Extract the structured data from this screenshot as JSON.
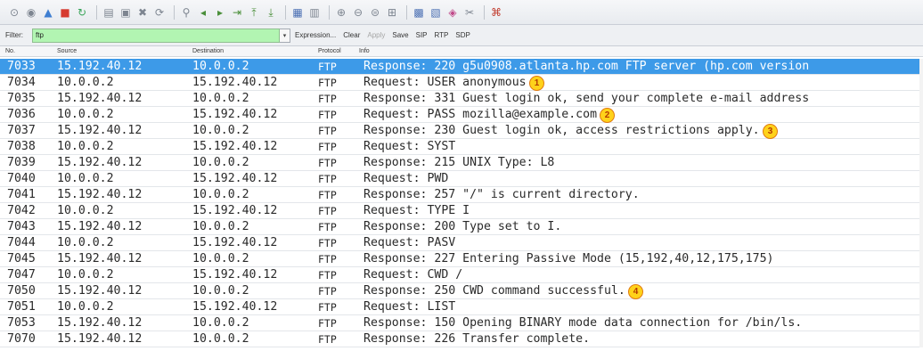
{
  "toolbar": {
    "icons": [
      {
        "name": "interface-list-icon",
        "glyph": "⊙",
        "color": "#7d8590"
      },
      {
        "name": "capture-options-icon",
        "glyph": "◉",
        "color": "#7d8590"
      },
      {
        "name": "start-capture-icon",
        "glyph": "▲",
        "color": "#3f7fd1"
      },
      {
        "name": "stop-capture-icon",
        "glyph": "■",
        "color": "#d63a2f"
      },
      {
        "name": "restart-capture-icon",
        "glyph": "↻",
        "color": "#3aa55a"
      },
      {
        "name": "sep",
        "glyph": ""
      },
      {
        "name": "open-file-icon",
        "glyph": "▤",
        "color": "#7d8590"
      },
      {
        "name": "save-file-icon",
        "glyph": "▣",
        "color": "#7d8590"
      },
      {
        "name": "close-file-icon",
        "glyph": "✖",
        "color": "#7d8590"
      },
      {
        "name": "reload-file-icon",
        "glyph": "⟳",
        "color": "#7d8590"
      },
      {
        "name": "sep",
        "glyph": ""
      },
      {
        "name": "find-packet-icon",
        "glyph": "⚲",
        "color": "#7d8590"
      },
      {
        "name": "go-back-icon",
        "glyph": "◂",
        "color": "#4a8f3a"
      },
      {
        "name": "go-forward-icon",
        "glyph": "▸",
        "color": "#4a8f3a"
      },
      {
        "name": "go-to-packet-icon",
        "glyph": "⇥",
        "color": "#4a8f3a"
      },
      {
        "name": "first-packet-icon",
        "glyph": "⤒",
        "color": "#4a8f3a"
      },
      {
        "name": "last-packet-icon",
        "glyph": "⤓",
        "color": "#4a8f3a"
      },
      {
        "name": "sep",
        "glyph": ""
      },
      {
        "name": "colorize-icon",
        "glyph": "▦",
        "color": "#4a6fb3"
      },
      {
        "name": "auto-scroll-icon",
        "glyph": "▥",
        "color": "#7d8590"
      },
      {
        "name": "sep",
        "glyph": ""
      },
      {
        "name": "zoom-in-icon",
        "glyph": "⊕",
        "color": "#7d8590"
      },
      {
        "name": "zoom-out-icon",
        "glyph": "⊖",
        "color": "#7d8590"
      },
      {
        "name": "normal-size-icon",
        "glyph": "⊜",
        "color": "#7d8590"
      },
      {
        "name": "resize-columns-icon",
        "glyph": "⊞",
        "color": "#7d8590"
      },
      {
        "name": "sep",
        "glyph": ""
      },
      {
        "name": "capture-filters-icon",
        "glyph": "▩",
        "color": "#4a6fb3"
      },
      {
        "name": "display-filters-icon",
        "glyph": "▧",
        "color": "#4a6fb3"
      },
      {
        "name": "coloring-rules-icon",
        "glyph": "◈",
        "color": "#c04a8a"
      },
      {
        "name": "preferences-icon",
        "glyph": "✂",
        "color": "#7d8590"
      },
      {
        "name": "sep",
        "glyph": ""
      },
      {
        "name": "help-icon",
        "glyph": "⌘",
        "color": "#c0392b"
      }
    ]
  },
  "filter": {
    "label": "Filter:",
    "value": "ftp",
    "dropdown_glyph": "▾",
    "buttons": [
      {
        "label": "Expression...",
        "disabled": false
      },
      {
        "label": "Clear",
        "disabled": false
      },
      {
        "label": "Apply",
        "disabled": true
      },
      {
        "label": "Save",
        "disabled": false
      },
      {
        "label": "SIP",
        "disabled": false
      },
      {
        "label": "RTP",
        "disabled": false
      },
      {
        "label": "SDP",
        "disabled": false
      }
    ]
  },
  "columns": {
    "no": "No.",
    "source": "Source",
    "destination": "Destination",
    "protocol": "Protocol",
    "info": "Info"
  },
  "packets": [
    {
      "no": "7033",
      "src": "15.192.40.12",
      "dst": "10.0.0.2",
      "proto": "FTP",
      "info": "Response: 220 g5u0908.atlanta.hp.com FTP server (hp.com version",
      "selected": true
    },
    {
      "no": "7034",
      "src": "10.0.0.2",
      "dst": "15.192.40.12",
      "proto": "FTP",
      "info": "Request: USER anonymous"
    },
    {
      "no": "7035",
      "src": "15.192.40.12",
      "dst": "10.0.0.2",
      "proto": "FTP",
      "info": "Response: 331 Guest login ok, send your complete e-mail address"
    },
    {
      "no": "7036",
      "src": "10.0.0.2",
      "dst": "15.192.40.12",
      "proto": "FTP",
      "info": "Request: PASS mozilla@example.com"
    },
    {
      "no": "7037",
      "src": "15.192.40.12",
      "dst": "10.0.0.2",
      "proto": "FTP",
      "info": "Response: 230 Guest login ok, access restrictions apply."
    },
    {
      "no": "7038",
      "src": "10.0.0.2",
      "dst": "15.192.40.12",
      "proto": "FTP",
      "info": "Request: SYST"
    },
    {
      "no": "7039",
      "src": "15.192.40.12",
      "dst": "10.0.0.2",
      "proto": "FTP",
      "info": "Response: 215 UNIX Type: L8"
    },
    {
      "no": "7040",
      "src": "10.0.0.2",
      "dst": "15.192.40.12",
      "proto": "FTP",
      "info": "Request: PWD"
    },
    {
      "no": "7041",
      "src": "15.192.40.12",
      "dst": "10.0.0.2",
      "proto": "FTP",
      "info": "Response: 257 \"/\" is current directory."
    },
    {
      "no": "7042",
      "src": "10.0.0.2",
      "dst": "15.192.40.12",
      "proto": "FTP",
      "info": "Request: TYPE I"
    },
    {
      "no": "7043",
      "src": "15.192.40.12",
      "dst": "10.0.0.2",
      "proto": "FTP",
      "info": "Response: 200 Type set to I."
    },
    {
      "no": "7044",
      "src": "10.0.0.2",
      "dst": "15.192.40.12",
      "proto": "FTP",
      "info": "Request: PASV"
    },
    {
      "no": "7045",
      "src": "15.192.40.12",
      "dst": "10.0.0.2",
      "proto": "FTP",
      "info": "Response: 227 Entering Passive Mode (15,192,40,12,175,175)"
    },
    {
      "no": "7047",
      "src": "10.0.0.2",
      "dst": "15.192.40.12",
      "proto": "FTP",
      "info": "Request: CWD /"
    },
    {
      "no": "7050",
      "src": "15.192.40.12",
      "dst": "10.0.0.2",
      "proto": "FTP",
      "info": "Response: 250 CWD command successful."
    },
    {
      "no": "7051",
      "src": "10.0.0.2",
      "dst": "15.192.40.12",
      "proto": "FTP",
      "info": "Request: LIST"
    },
    {
      "no": "7053",
      "src": "15.192.40.12",
      "dst": "10.0.0.2",
      "proto": "FTP",
      "info": "Response: 150 Opening BINARY mode data connection for /bin/ls."
    },
    {
      "no": "7070",
      "src": "15.192.40.12",
      "dst": "10.0.0.2",
      "proto": "FTP",
      "info": "Response: 226 Transfer complete."
    }
  ],
  "callouts": [
    {
      "label": "1",
      "row": 1
    },
    {
      "label": "2",
      "row": 3
    },
    {
      "label": "3",
      "row": 4
    },
    {
      "label": "4",
      "row": 14
    }
  ]
}
